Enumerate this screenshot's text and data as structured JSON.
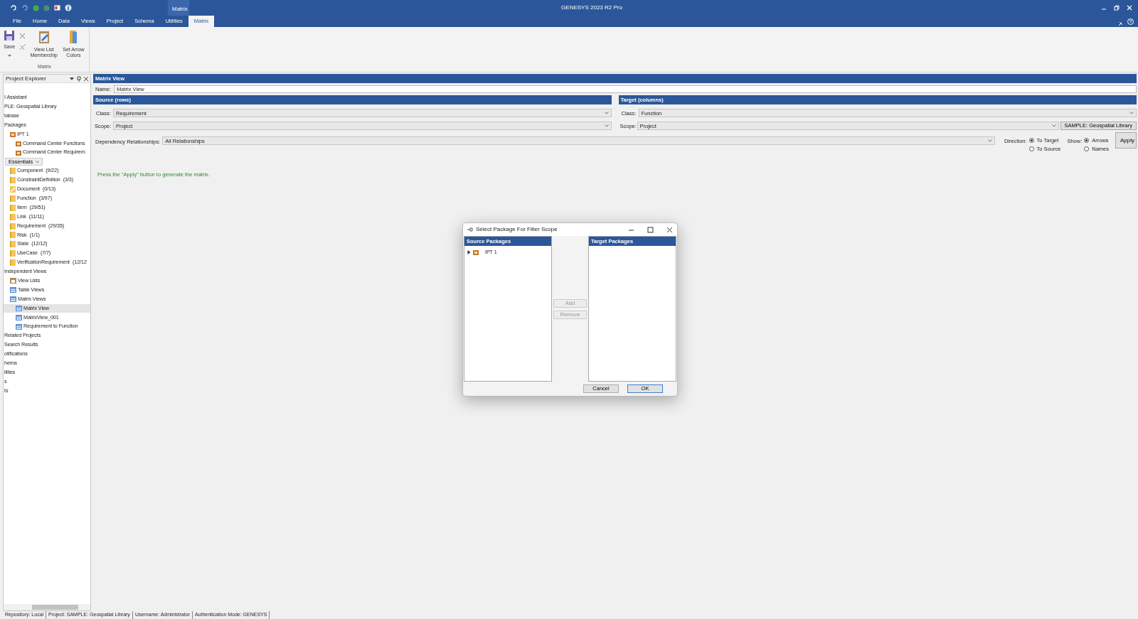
{
  "window": {
    "title": "GENESYS 2023 R2 Pro",
    "context_tab": "Matrix"
  },
  "ribbon": {
    "tabs": [
      {
        "label": "File",
        "selected": false
      },
      {
        "label": "Home",
        "selected": false
      },
      {
        "label": "Data",
        "selected": false
      },
      {
        "label": "Views",
        "selected": false
      },
      {
        "label": "Project",
        "selected": false
      },
      {
        "label": "Schema",
        "selected": false
      },
      {
        "label": "Utilities",
        "selected": false
      },
      {
        "label": "Matrix",
        "selected": true
      }
    ],
    "group_label": "Matrix",
    "buttons": [
      {
        "kind": "save",
        "label": "Save"
      },
      {
        "kind": "small_pair"
      },
      {
        "kind": "membership",
        "label": "View List Membership"
      },
      {
        "kind": "arrow_colors",
        "label": "Set Arrow Colors"
      }
    ]
  },
  "explorer": {
    "title": "Project Explorer",
    "items": [
      {
        "label": "I Assistant",
        "kind": "plain",
        "selected": false
      },
      {
        "label": "PLE: Geospatial Library",
        "kind": "plain",
        "selected": false
      },
      {
        "label": "tabase",
        "kind": "plain",
        "selected": false
      },
      {
        "label": "Packages",
        "kind": "plain",
        "selected": false,
        "children": [
          {
            "label": "IPT 1",
            "kind": "package",
            "selected": false,
            "children": [
              {
                "label": "Command Center Functions",
                "kind": "package",
                "selected": false
              },
              {
                "label": "Command Center Requirem",
                "kind": "package",
                "selected": false
              }
            ]
          }
        ]
      },
      {
        "label": "Essentials",
        "kind": "filter",
        "selected": false,
        "children": [
          {
            "label": "Component",
            "count": "(9/22)",
            "kind": "folder",
            "selected": false
          },
          {
            "label": "ConstraintDefinition",
            "count": "(3/3)",
            "kind": "folder",
            "selected": false
          },
          {
            "label": "Document",
            "count": "(0/13)",
            "kind": "document",
            "selected": false
          },
          {
            "label": "Function",
            "count": "(3/97)",
            "kind": "folder",
            "selected": false
          },
          {
            "label": "Item",
            "count": "(29/51)",
            "kind": "folder",
            "selected": false
          },
          {
            "label": "Link",
            "count": "(11/11)",
            "kind": "folder",
            "selected": false
          },
          {
            "label": "Requirement",
            "count": "(29/35)",
            "kind": "folder",
            "selected": false
          },
          {
            "label": "Risk",
            "count": "(1/1)",
            "kind": "folder",
            "selected": false
          },
          {
            "label": "State",
            "count": "(12/12)",
            "kind": "folder",
            "selected": false
          },
          {
            "label": "UseCase",
            "count": "(7/7)",
            "kind": "folder",
            "selected": false
          },
          {
            "label": "VerificationRequirement",
            "count": "(12/12",
            "kind": "folder",
            "selected": false
          }
        ]
      },
      {
        "label": "Independent Views",
        "kind": "plain",
        "selected": false,
        "children": [
          {
            "label": "View Lists",
            "kind": "viewlist",
            "selected": false
          },
          {
            "label": "Table Views",
            "kind": "view",
            "selected": false
          },
          {
            "label": "Matrix Views",
            "kind": "view",
            "selected": false,
            "children": [
              {
                "label": "Matrix View",
                "kind": "view",
                "selected": true
              },
              {
                "label": "MatrixView_001",
                "kind": "view",
                "selected": false
              },
              {
                "label": "Requirement to Function",
                "kind": "view",
                "selected": false
              }
            ]
          }
        ]
      },
      {
        "label": "Related Projects",
        "kind": "plain",
        "selected": false
      },
      {
        "label": "Search Results",
        "kind": "plain",
        "selected": false
      },
      {
        "label": "otifications",
        "kind": "plain",
        "selected": false
      },
      {
        "label": "hema",
        "kind": "plain",
        "selected": false
      },
      {
        "label": "ilities",
        "kind": "plain",
        "selected": false
      },
      {
        "label": "s",
        "kind": "plain",
        "selected": false
      },
      {
        "label": "ts",
        "kind": "plain",
        "selected": false
      }
    ]
  },
  "matrix_view": {
    "title": "Matrix View",
    "name_label": "Name:",
    "name": "Matrix View",
    "source": {
      "title": "Source (rows)",
      "class_label": "Class:",
      "class": "Requirement",
      "scope_label": "Scope:",
      "scope": "Project"
    },
    "target": {
      "title": "Target (columns)",
      "class_label": "Class:",
      "class": "Function",
      "scope_label": "Scope:",
      "scope": "Project",
      "scope_button": "SAMPLE: Geospatial Library"
    },
    "dependency": {
      "label": "Dependency Relationships:",
      "value": "All Relationships"
    },
    "direction": {
      "label": "Direction:",
      "options": [
        {
          "label": "To Target",
          "selected": true
        },
        {
          "label": "To Source",
          "selected": false
        }
      ]
    },
    "show": {
      "label": "Show:",
      "options": [
        {
          "label": "Arrows",
          "selected": true
        },
        {
          "label": "Names",
          "selected": false
        }
      ]
    },
    "apply_button": "Apply",
    "message": "Press the \"Apply\" button to generate the matrix."
  },
  "dialog": {
    "title": "Select Package For Filter Scope",
    "source": {
      "title": "Source Packages",
      "items": [
        {
          "label": "IPT 1",
          "expanded": false
        }
      ]
    },
    "target": {
      "title": "Target Packages"
    },
    "add_button": {
      "label": "Add",
      "disabled": true
    },
    "remove_button": {
      "label": "Remove",
      "disabled": true
    },
    "cancel_button": "Cancel",
    "ok_button": "OK"
  },
  "status_bar": [
    "Repository: Local",
    "Project: SAMPLE: Geospatial Library",
    "Username: Administrator",
    "Authentication Mode: GENESYS"
  ]
}
